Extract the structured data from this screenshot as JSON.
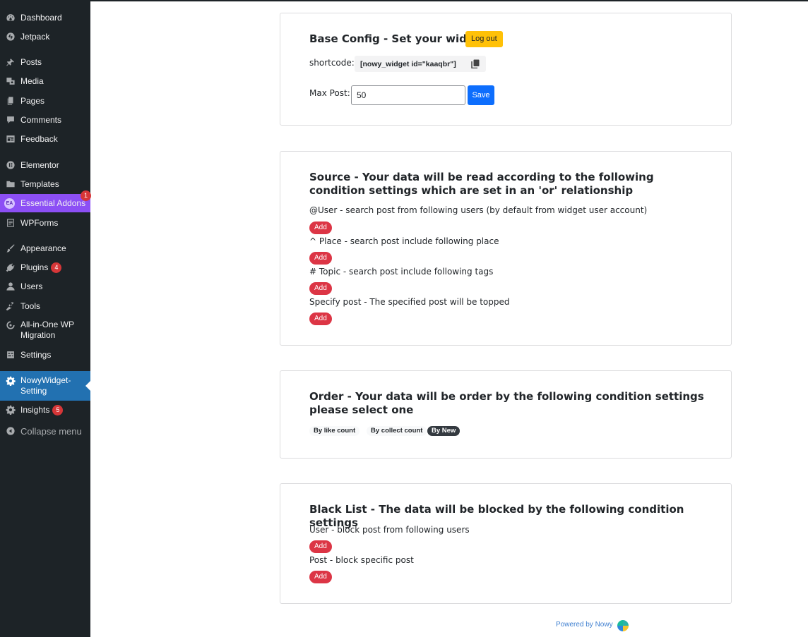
{
  "sidebar": {
    "items": [
      {
        "label": "Dashboard",
        "icon": "dashboard-icon"
      },
      {
        "label": "Jetpack",
        "icon": "jetpack-icon"
      },
      {
        "label": "Posts",
        "icon": "pin-icon"
      },
      {
        "label": "Media",
        "icon": "media-icon"
      },
      {
        "label": "Pages",
        "icon": "pages-icon"
      },
      {
        "label": "Comments",
        "icon": "comments-icon"
      },
      {
        "label": "Feedback",
        "icon": "feedback-icon"
      },
      {
        "label": "Elementor",
        "icon": "elementor-icon"
      },
      {
        "label": "Templates",
        "icon": "folder-icon"
      },
      {
        "label": "Essential Addons",
        "icon": "essential-addons-icon",
        "badge": "1"
      },
      {
        "label": "WPForms",
        "icon": "wpforms-icon"
      },
      {
        "label": "Appearance",
        "icon": "brush-icon"
      },
      {
        "label": "Plugins",
        "icon": "plugin-icon",
        "badge": "4"
      },
      {
        "label": "Users",
        "icon": "user-icon"
      },
      {
        "label": "Tools",
        "icon": "wrench-icon"
      },
      {
        "label": "All-in-One WP Migration",
        "icon": "migration-icon"
      },
      {
        "label": "Settings",
        "icon": "settings-icon"
      },
      {
        "label": "NowyWidget-Setting",
        "icon": "gear-icon"
      },
      {
        "label": "Insights",
        "icon": "insights-icon",
        "badge": "5"
      },
      {
        "label": "Collapse menu",
        "icon": "collapse-icon"
      }
    ],
    "accent_color": "#2271b1",
    "ea_color": "#8c4ff5"
  },
  "base_config": {
    "title": "Base Config - Set your widget",
    "logout_label": "Log out",
    "shortcode_label": "shortcode:",
    "shortcode_value": "[nowy_widget id=\"kaaqbr\"]",
    "max_post_label": "Max Post:",
    "max_post_value": "50",
    "save_label": "Save"
  },
  "source": {
    "title": "Source - Your data will be read according to the following condition settings which are set in an 'or' relationship",
    "rows": [
      {
        "text": "@User - search post from following users (by default from widget user account)",
        "button": "Add"
      },
      {
        "text": "^ Place - search post include following place",
        "button": "Add"
      },
      {
        "text": "# Topic - search post include following tags",
        "button": "Add"
      },
      {
        "text": "Specify post - The specified post will be topped",
        "button": "Add"
      }
    ]
  },
  "order": {
    "title": "Order - Your data will be order by the following condition settings please select one",
    "options": [
      "By like count",
      "By collect count",
      "By New"
    ],
    "selected": "By New"
  },
  "blacklist": {
    "title": "Black List - The data will be blocked by the following condition settings",
    "rows": [
      {
        "text": "User - block post from following users",
        "button": "Add"
      },
      {
        "text": "Post - block specific post",
        "button": "Add"
      }
    ]
  },
  "footer": {
    "powered_by": "Powered by Nowy"
  },
  "colors": {
    "danger": "#dc3545",
    "warning": "#ffc107",
    "primary": "#0d6efd",
    "dark_pill": "#343a40"
  }
}
